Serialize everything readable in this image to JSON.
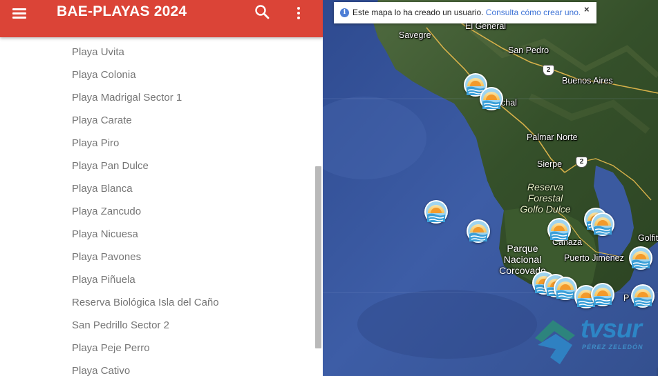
{
  "header": {
    "title": "BAE-PLAYAS 2024",
    "menu_icon": "hamburger-menu-icon",
    "search_icon": "search-icon",
    "more_icon": "more-vert-icon",
    "bg_color": "#db4437"
  },
  "places": [
    "Playa Uvita",
    "Playa Colonia",
    "Playa Madrigal Sector 1",
    "Playa Carate",
    "Playa Piro",
    "Playa Pan Dulce",
    "Playa Blanca",
    "Playa Zancudo",
    "Playa Nicuesa",
    "Playa Pavones",
    "Playa Piñuela",
    "Reserva Biológica Isla del Caño",
    "San Pedrillo Sector 2",
    "Playa Peje Perro",
    "Playa Cativo"
  ],
  "notice": {
    "text": "Este mapa lo ha creado un usuario.",
    "link": "Consulta cómo crear uno.",
    "close": "×"
  },
  "map": {
    "labels": {
      "el_general": "El General",
      "savegre": "Savegre",
      "san_pedro": "San Pedro",
      "buenos_aires": "Buenos Aires",
      "chal": "chal",
      "palmar_norte": "Palmar Norte",
      "sierpe": "Sierpe",
      "reserva_l1": "Reserva",
      "reserva_l2": "Forestal",
      "reserva_l3": "Golfo Dulce",
      "parque_l1": "Parque",
      "parque_l2": "Nacional",
      "parque_l3": "Corcovado",
      "canaza": "Cañaza",
      "puerto_jimenez": "Puerto Jiménez",
      "golfito": "Golfit",
      "p_label": "P"
    },
    "route_2": "2",
    "marker_icon": "beach-sunset-icon",
    "zoom_label": "+"
  },
  "watermark": {
    "brand": "tvsur",
    "sub": "PÉREZ ZELEDÓN"
  }
}
